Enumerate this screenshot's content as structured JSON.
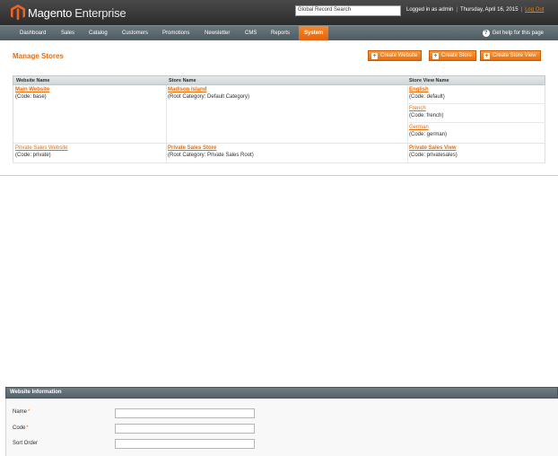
{
  "header": {
    "brand": "Magento",
    "edition": "Enterprise",
    "search_value": "Global Record Search",
    "logged_in": "Logged in as admin",
    "date": "Thursday, April 16, 2015",
    "logout": "Log Out"
  },
  "nav": {
    "items": [
      "Dashboard",
      "Sales",
      "Catalog",
      "Customers",
      "Promotions",
      "Newsletter",
      "CMS",
      "Reports",
      "System"
    ],
    "active": "System",
    "help": "Get help for this page"
  },
  "page": {
    "title": "Manage Stores",
    "buttons": {
      "create_website": "Create Website",
      "create_store": "Create Store",
      "create_store_view": "Create Store View"
    }
  },
  "grid": {
    "columns": [
      "Website Name",
      "Store Name",
      "Store View Name"
    ],
    "rows": [
      {
        "website": "Main Website",
        "website_code": "(Code: base)",
        "store": "Madison Island",
        "store_root": "(Root Category: Default Category)",
        "views": [
          {
            "name": "English",
            "code": "(Code: default)"
          },
          {
            "name": "French",
            "code": "(Code: french)"
          },
          {
            "name": "German",
            "code": "(Code: german)"
          }
        ]
      },
      {
        "website": "Private Sales Website",
        "website_code": "(Code: private)",
        "store": "Private Sales Store",
        "store_root": "(Root Category: Private Sales Root)",
        "views": [
          {
            "name": "Private Sales View",
            "code": "(Code: privatesales)"
          }
        ]
      }
    ]
  },
  "website_info": {
    "title": "Website Information",
    "fields": {
      "name": "Name",
      "code": "Code",
      "sort_order": "Sort Order"
    },
    "required_mark": "*"
  },
  "colors": {
    "accent": "#e96c0c",
    "header_bg": "#2b2b2b",
    "nav_bg": "#56626a"
  }
}
